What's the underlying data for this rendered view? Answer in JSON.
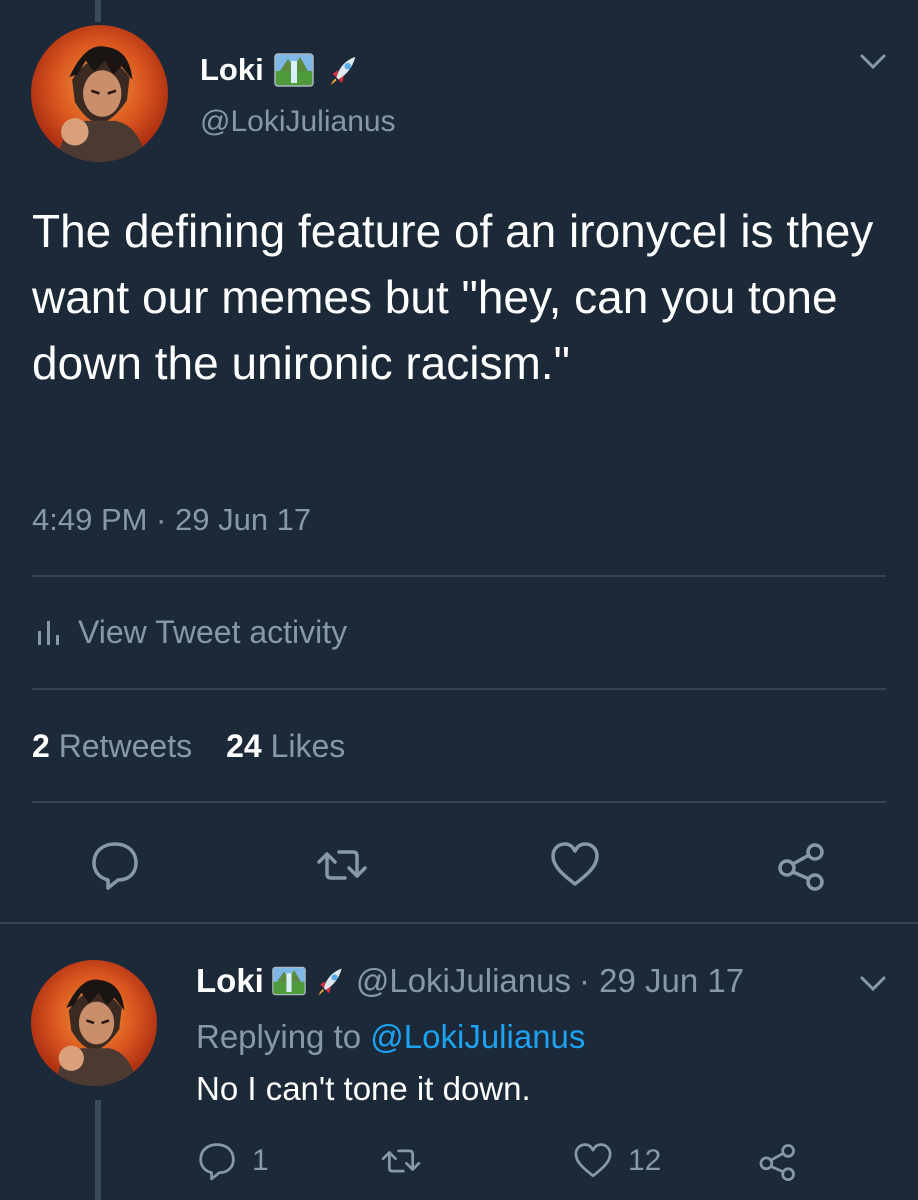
{
  "tweet": {
    "author_name": "Loki",
    "author_handle": "@LokiJulianus",
    "text": "The defining feature of an ironycel is they want our memes but \"hey, can you tone down the unironic racism.\"",
    "timestamp": "4:49 PM · 29 Jun 17",
    "activity_label": "View Tweet activity",
    "retweets_count": "2",
    "retweets_label": "Retweets",
    "likes_count": "24",
    "likes_label": "Likes",
    "icons": [
      "waterfall-emoji-icon",
      "rocket-emoji-icon",
      "chevron-down-icon",
      "bar-chart-icon",
      "reply-icon",
      "retweet-icon",
      "heart-icon",
      "share-icon"
    ]
  },
  "reply": {
    "author_name": "Loki",
    "author_handle": "@LokiJulianus",
    "date": "· 29 Jun 17",
    "replying_prefix": "Replying to",
    "replying_to": "@LokiJulianus",
    "text": "No I can't tone it down.",
    "reply_count": "1",
    "like_count": "12"
  },
  "colors": {
    "background": "#1c2938",
    "text_primary": "#ffffff",
    "text_secondary": "#8899a6",
    "link": "#1da1f2",
    "divider": "#38444d"
  }
}
